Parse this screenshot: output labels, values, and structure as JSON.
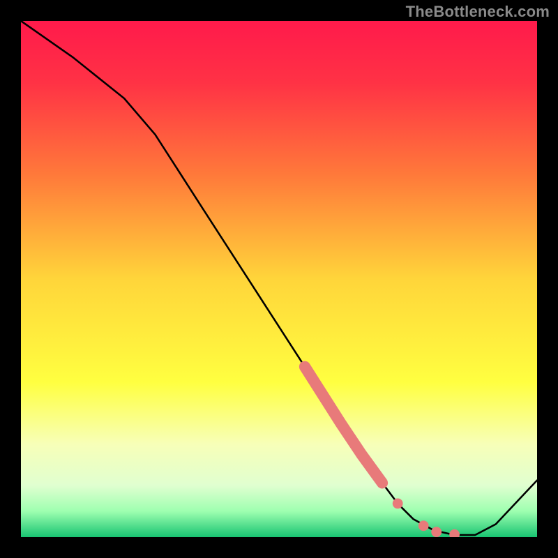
{
  "watermark": "TheBottleneck.com",
  "chart_data": {
    "type": "line",
    "title": "",
    "xlabel": "",
    "ylabel": "",
    "xlim": [
      0,
      100
    ],
    "ylim": [
      0,
      100
    ],
    "background_gradient": {
      "stops": [
        {
          "pos": 0.0,
          "color": "#ff1a4b"
        },
        {
          "pos": 0.12,
          "color": "#ff3245"
        },
        {
          "pos": 0.3,
          "color": "#ff7a3a"
        },
        {
          "pos": 0.5,
          "color": "#ffd53a"
        },
        {
          "pos": 0.7,
          "color": "#ffff40"
        },
        {
          "pos": 0.82,
          "color": "#f7ffb8"
        },
        {
          "pos": 0.9,
          "color": "#e0ffd0"
        },
        {
          "pos": 0.95,
          "color": "#9effb0"
        },
        {
          "pos": 1.0,
          "color": "#18c472"
        }
      ]
    },
    "series": [
      {
        "name": "curve",
        "x": [
          0,
          10,
          20,
          26,
          35,
          45,
          55,
          62,
          66,
          70,
          73,
          76,
          80,
          84,
          88,
          92,
          100
        ],
        "y": [
          100,
          93,
          85,
          78,
          64,
          48.5,
          33,
          22,
          16,
          10.5,
          6.5,
          3.5,
          1.3,
          0.4,
          0.4,
          2.5,
          11
        ]
      }
    ],
    "highlight_segments": [
      {
        "name": "thick-pink-segment",
        "x": [
          55,
          62,
          66,
          70
        ],
        "y": [
          33,
          22,
          16,
          10.5
        ]
      }
    ],
    "highlight_points": [
      {
        "x": 73,
        "y": 6.5
      },
      {
        "x": 78,
        "y": 2.2
      },
      {
        "x": 80.5,
        "y": 1.0
      },
      {
        "x": 84,
        "y": 0.5
      }
    ]
  }
}
